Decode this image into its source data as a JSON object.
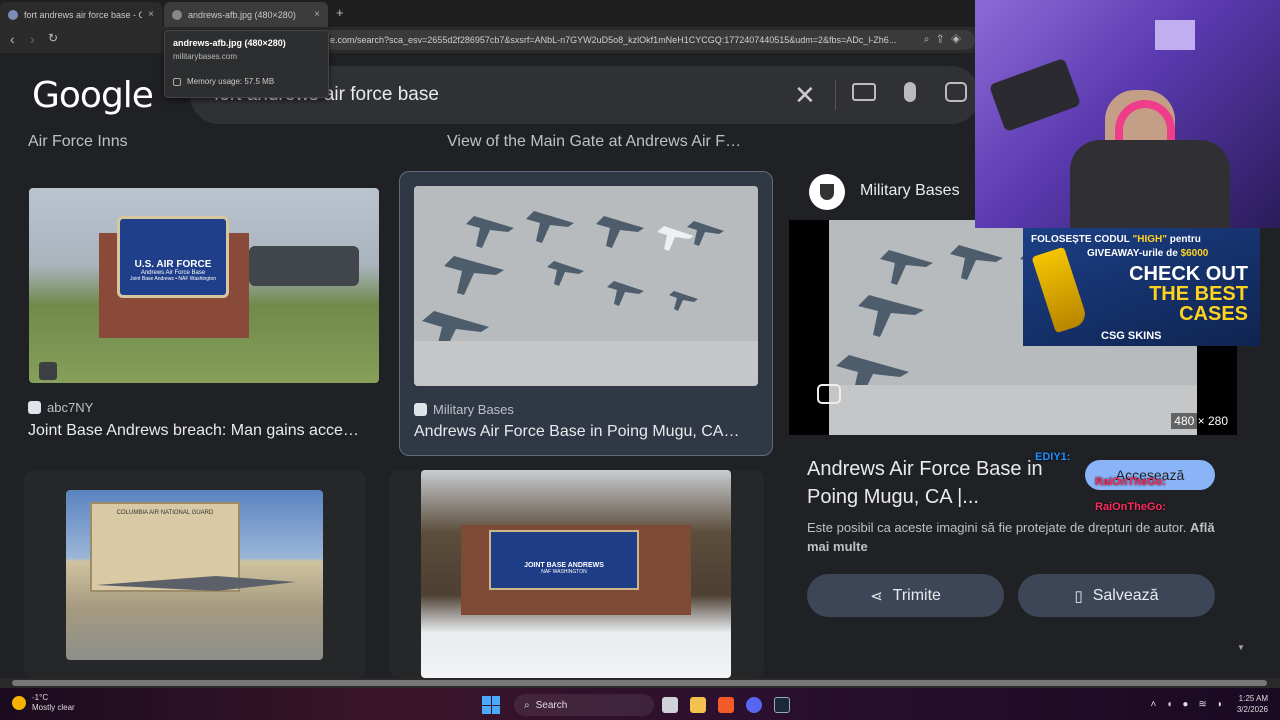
{
  "browser": {
    "tabs": [
      {
        "title": "fort andrews air force base - Că",
        "close": "×"
      },
      {
        "title": "andrews-afb.jpg (480×280)",
        "close": "×"
      }
    ],
    "new_tab": "+",
    "url": "e.com/search?sca_esv=2655d2f286957cb7&sxsrf=ANbL-n7GYW2uD5o8_kzlOkf1mNeH1CYCGQ:1772407440515&udm=2&fbs=ADc_l-Zh6...",
    "tooltip": {
      "title": "andrews-afb.jpg (480×280)",
      "domain": "militarybases.com",
      "memory": "Memory usage: 57.5 MB"
    }
  },
  "google": {
    "logo": "Google",
    "query": "fort andrews air force base"
  },
  "results": {
    "above_captions": [
      "Air Force Inns",
      "View of the Main Gate at Andrews Air F…"
    ],
    "items": [
      {
        "source": "abc7NY",
        "caption": "Joint Base Andrews breach: Man gains acce…",
        "sign_line1": "U.S. AIR FORCE",
        "sign_line2": "Andrews Air Force Base",
        "sign_line3": "Joint Base Andrews • NAF Washington"
      },
      {
        "source": "Military Bases",
        "caption": "Andrews Air Force Base in Poing Mugu, CA…"
      },
      {
        "sign_text": "COLUMBIA AIR NATIONAL GUARD"
      },
      {
        "sign_line1": "JOINT BASE ANDREWS",
        "sign_line2": "NAF WASHINGTON"
      }
    ]
  },
  "panel": {
    "source_name": "Military Bases",
    "dimensions": "480 × 280",
    "title": "Andrews Air Force Base in Poing Mugu, CA |...",
    "visit_label": "Accesează",
    "note": "Este posibil ca aceste imagini să fie protejate de drepturi de autor.",
    "note_link": "Află mai multe",
    "share_label": "Trimite",
    "save_label": "Salvează"
  },
  "overlay": {
    "promo_line1": "FOLOSEȘTE CODUL",
    "promo_code": "\"HIGH\"",
    "promo_line1_end": "pentru",
    "promo_line2": "GIVEAWAY-urile de",
    "promo_amount": "$6000",
    "promo_cta1": "CHECK OUT",
    "promo_cta2": "THE BEST",
    "promo_cta3": "CASES",
    "promo_brand": "CSG SKINS",
    "chat": [
      {
        "name": "EDIY1:",
        "color": "#1e90ff"
      },
      {
        "name": "RaiOnTheGo:",
        "color": "#ff2a5f"
      },
      {
        "name": "RaiOnTheGo:",
        "color": "#ff2a5f"
      }
    ]
  },
  "taskbar": {
    "temp": "-1°C",
    "weather": "Mostly clear",
    "search": "Search",
    "time": "1:25 AM",
    "date": "3/2/2026"
  }
}
